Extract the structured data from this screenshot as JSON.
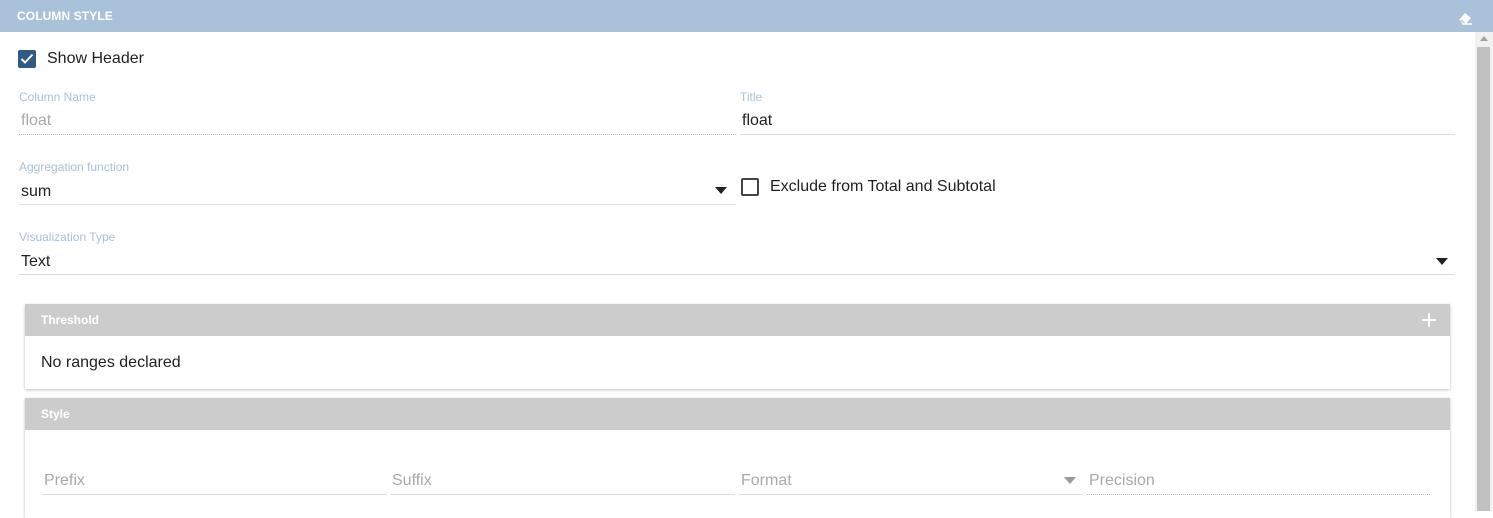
{
  "dialog": {
    "title": "COLUMN STYLE",
    "clear_icon": "eraser-icon"
  },
  "show_header": {
    "label": "Show Header",
    "checked": true
  },
  "column_name": {
    "label": "Column Name",
    "value": "float"
  },
  "title_field": {
    "label": "Title",
    "value": "float"
  },
  "aggregation": {
    "label": "Aggregation function",
    "value": "sum"
  },
  "exclude_total": {
    "label": "Exclude from Total and Subtotal",
    "checked": false
  },
  "visualization": {
    "label": "Visualization Type",
    "value": "Text"
  },
  "threshold": {
    "title": "Threshold",
    "add_icon": "plus-icon",
    "empty_text": "No ranges declared"
  },
  "style": {
    "title": "Style",
    "prefix_placeholder": "Prefix",
    "suffix_placeholder": "Suffix",
    "format_placeholder": "Format",
    "precision_placeholder": "Precision"
  },
  "colors": {
    "header_bg": "#a9c2d9",
    "checkbox_checked": "#2e5a85",
    "panel_header": "#cccccc",
    "label": "#a9c2d9"
  }
}
